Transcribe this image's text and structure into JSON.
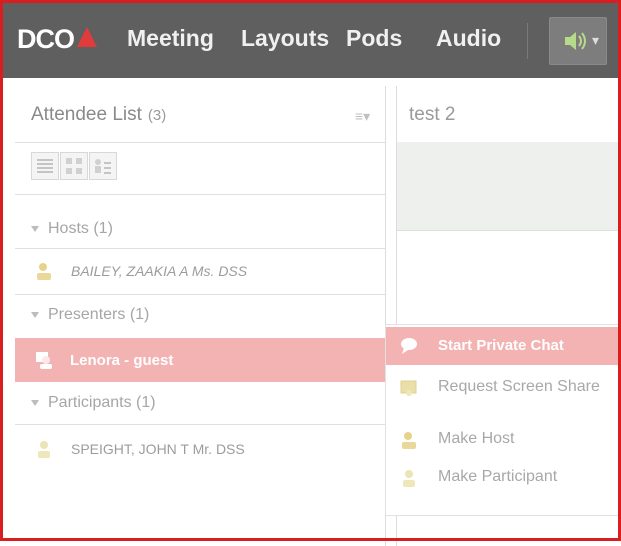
{
  "app": {
    "logo_text": "DCO"
  },
  "menubar": {
    "items": [
      "Meeting",
      "Layouts",
      "Pods",
      "Audio"
    ],
    "audio_icon": "speaker-icon"
  },
  "attendee_pod": {
    "title": "Attendee List",
    "count": "(3)",
    "menu_icon": "pod-menu-icon",
    "view_icons": [
      "list-view-icon",
      "grid-view-icon",
      "sort-view-icon"
    ],
    "groups": [
      {
        "label": "Hosts (1)",
        "members": [
          {
            "name": "BAILEY, ZAAKIA A Ms. DSS",
            "italic": true
          }
        ]
      },
      {
        "label": "Presenters (1)",
        "members": [
          {
            "name": "Lenora - guest",
            "selected": true
          }
        ]
      },
      {
        "label": "Participants (1)",
        "members": [
          {
            "name": "SPEIGHT, JOHN T Mr. DSS"
          }
        ]
      }
    ]
  },
  "chat_pod": {
    "title": "test 2"
  },
  "context_menu": {
    "items": [
      {
        "label": "Start Private Chat",
        "icon": "chat-bubble-icon",
        "active": true
      },
      {
        "label": "Request Screen Share",
        "icon": "screen-share-icon"
      },
      {
        "label": "Make Host",
        "icon": "host-icon"
      },
      {
        "label": "Make Participant",
        "icon": "participant-icon"
      }
    ]
  },
  "colors": {
    "topbar": "#5f5f5f",
    "highlight": "#f3b3b3",
    "frame": "#d81e1e",
    "logo_triangle": "#e23b3b",
    "speaker": "#b7d98a"
  }
}
